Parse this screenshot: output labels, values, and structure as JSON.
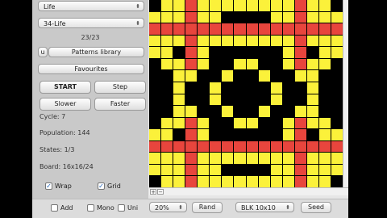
{
  "rule_select": {
    "value": "Life"
  },
  "pattern_select": {
    "value": "34-Life"
  },
  "pattern_counter": "23/23",
  "library": {
    "u_label": "u",
    "button": "Patterns library"
  },
  "favourites_label": "Favourites",
  "buttons": {
    "start": "START",
    "step": "Step",
    "slower": "Slower",
    "faster": "Faster"
  },
  "stats": {
    "cycle": "Cycle: 7",
    "population": "Population: 144",
    "states": "States: 1/3",
    "board": "Board: 16x16/24"
  },
  "options": {
    "wrap": {
      "label": "Wrap",
      "checked": true
    },
    "grid": {
      "label": "Grid",
      "checked": true
    }
  },
  "bottom": {
    "add": {
      "label": "Add",
      "checked": false
    },
    "mono": {
      "label": "Mono",
      "checked": false
    },
    "uni": {
      "label": "Uni",
      "checked": false
    },
    "zoom": "20%",
    "rand": "Rand",
    "blk": "BLK 10x10",
    "seed": "Seed"
  },
  "scroll": {
    "plus": "+",
    "minus": "−"
  },
  "colors": {
    "alive": "#fbf13a",
    "born": "#e8453d",
    "dead": "#000000"
  },
  "board_rows": [
    ".YYRYYYYYYYYRYY.",
    "YYYRYY....YYRYYY",
    "RRRRRRRRRRRRRRRR",
    "YYYRYYYYYYYYRYYY",
    "YY.RY......YR.YY",
    ".YYRY..YY..YRYY.",
    "..YY..Y..Y..YY..",
    "..Y..Y....Y..Y..",
    "..Y..Y....Y..Y..",
    "..YY..Y..Y..YY..",
    ".YYRY..YY..YRYY.",
    "YY.RY......YR.YY",
    "RRRRRRRRRRRRRRRR",
    "YYYRYYYYYYYYRYYY",
    "YYYRYY....YYRYYY",
    ".YYRYYYYYYYYRYY."
  ]
}
